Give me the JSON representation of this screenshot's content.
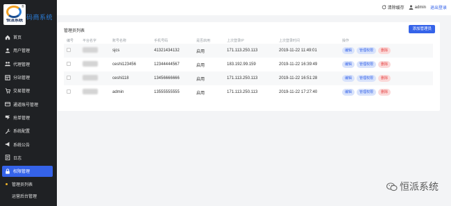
{
  "app": {
    "logo_text": "恒派系统",
    "logo_reg": "®",
    "title": "码商系统"
  },
  "sidebar": {
    "items": [
      {
        "label": "首页",
        "icon": "home-icon"
      },
      {
        "label": "用户管理",
        "icon": "users-icon"
      },
      {
        "label": "代理管理",
        "icon": "agent-icon"
      },
      {
        "label": "分站管理",
        "icon": "site-icon"
      },
      {
        "label": "交易管理",
        "icon": "trade-icon"
      },
      {
        "label": "通道账号管理",
        "icon": "channel-icon"
      },
      {
        "label": "抢单管理",
        "icon": "grab-icon"
      },
      {
        "label": "系统配置",
        "icon": "wrench-icon"
      },
      {
        "label": "系统公告",
        "icon": "bullhorn-icon"
      },
      {
        "label": "日志",
        "icon": "log-icon"
      },
      {
        "label": "权限管理",
        "icon": "lock-icon",
        "active": true
      }
    ],
    "sub_items": [
      {
        "label": "管理员列表"
      },
      {
        "label": "运营后台管理"
      }
    ]
  },
  "topbar": {
    "clear_cache": "清除缓存",
    "username": "admin",
    "logout": "退出登录"
  },
  "card": {
    "title": "管理员列表",
    "add_button": "添加管理员"
  },
  "table": {
    "headers": {
      "id": "编号",
      "platform": "平台名字",
      "account": "账号名称",
      "phone": "手机号码",
      "enabled": "是否启用",
      "last_ip": "上次登录IP",
      "last_time": "上次登录时间",
      "ops": "操作"
    },
    "rows": [
      {
        "account": "sjcs",
        "phone": "41321434132",
        "enabled": "启用",
        "last_ip": "171.113.250.113",
        "last_time": "2019-11-22 11:49:01"
      },
      {
        "account": "ceshi123456",
        "phone": "12344444567",
        "enabled": "启用",
        "last_ip": "183.192.99.159",
        "last_time": "2019-11-22 16:39:49"
      },
      {
        "account": "ceshi118",
        "phone": "13456666666",
        "enabled": "启用",
        "last_ip": "171.113.250.113",
        "last_time": "2019-11-22 16:51:28"
      },
      {
        "account": "admin",
        "phone": "13555555555",
        "enabled": "启用",
        "last_ip": "171.113.250.113",
        "last_time": "2019-11-22 17:27:40"
      }
    ],
    "op_labels": {
      "edit": "编辑",
      "perm": "管理权限",
      "delete": "删除"
    }
  },
  "watermark": {
    "text": "恒派系统"
  },
  "colors": {
    "sidebar_bg": "#1f2124",
    "accent": "#3563e9",
    "danger": "#e54545",
    "logo_orange": "#f0a023"
  }
}
